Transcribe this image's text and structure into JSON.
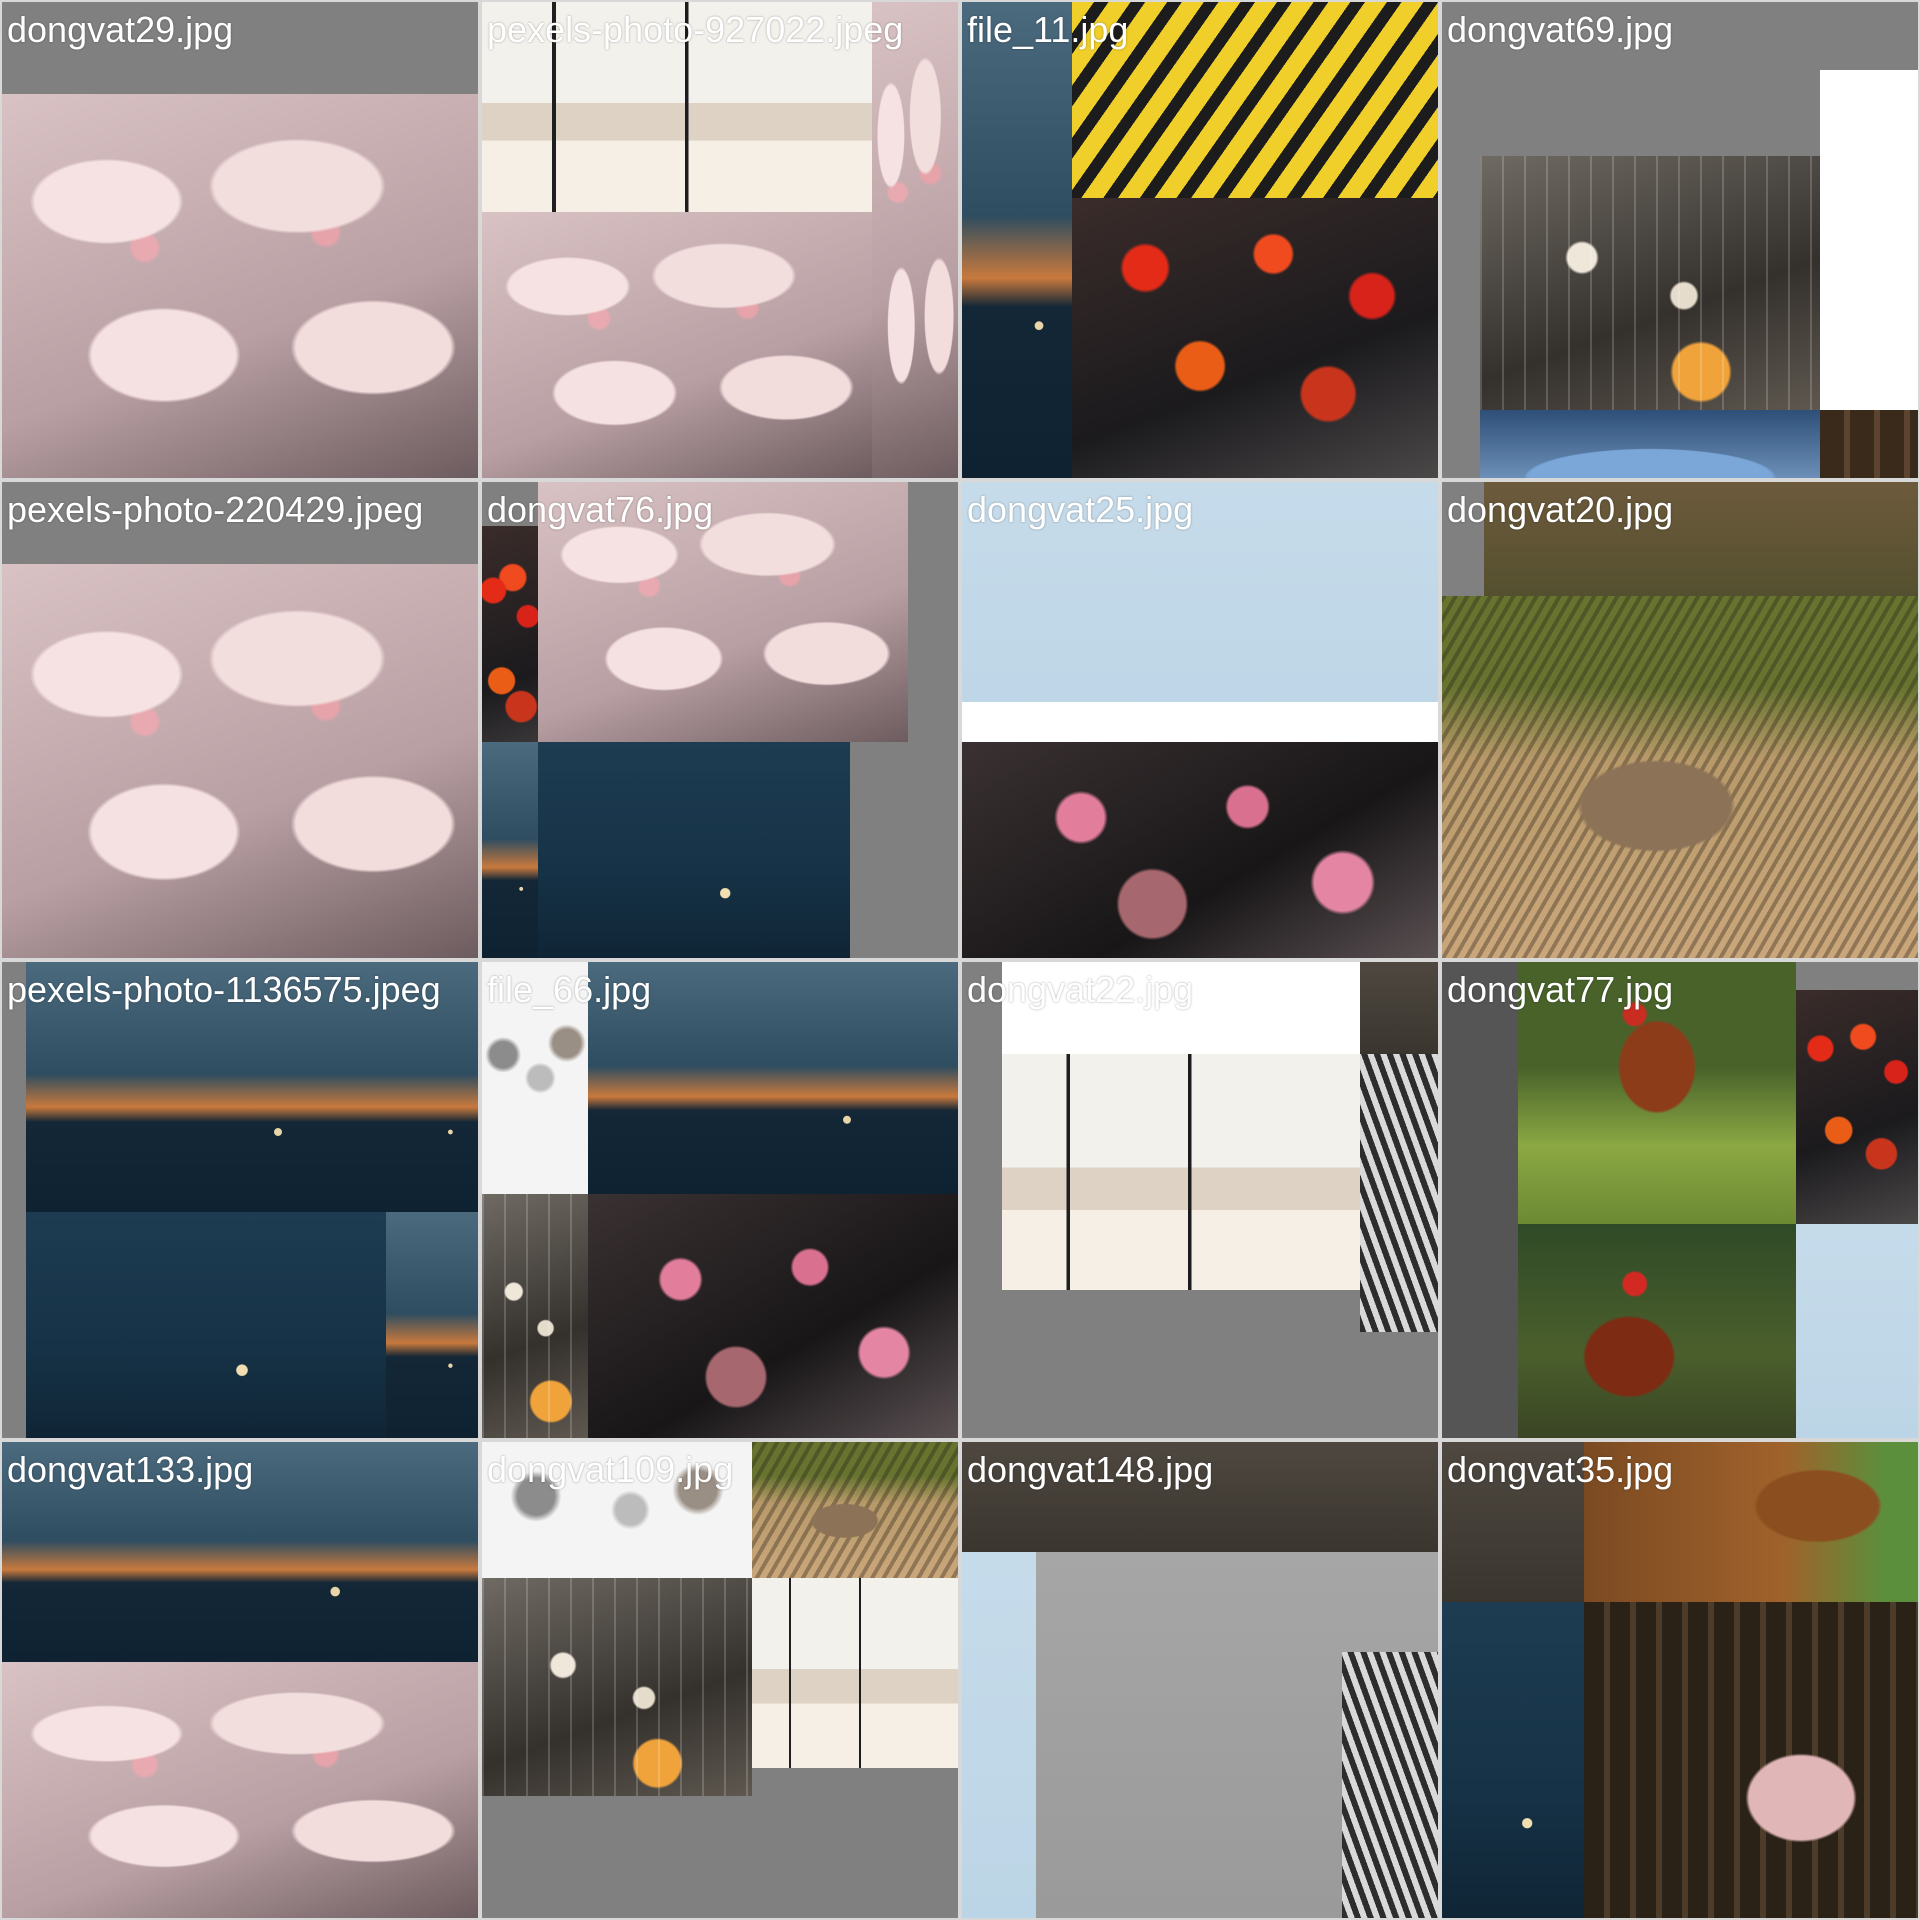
{
  "tiles": [
    {
      "caption": "dongvat29.jpg"
    },
    {
      "caption": "pexels-photo-927022.jpeg"
    },
    {
      "caption": "file_11.jpg"
    },
    {
      "caption": "dongvat69.jpg"
    },
    {
      "caption": "pexels-photo-220429.jpeg"
    },
    {
      "caption": "dongvat76.jpg"
    },
    {
      "caption": "dongvat25.jpg"
    },
    {
      "caption": "dongvat20.jpg"
    },
    {
      "caption": "pexels-photo-1136575.jpeg"
    },
    {
      "caption": "file_66.jpg"
    },
    {
      "caption": "dongvat22.jpg"
    },
    {
      "caption": "dongvat77.jpg"
    },
    {
      "caption": "dongvat133.jpg"
    },
    {
      "caption": "dongvat109.jpg"
    },
    {
      "caption": "dongvat148.jpg"
    },
    {
      "caption": "dongvat35.jpg"
    }
  ]
}
